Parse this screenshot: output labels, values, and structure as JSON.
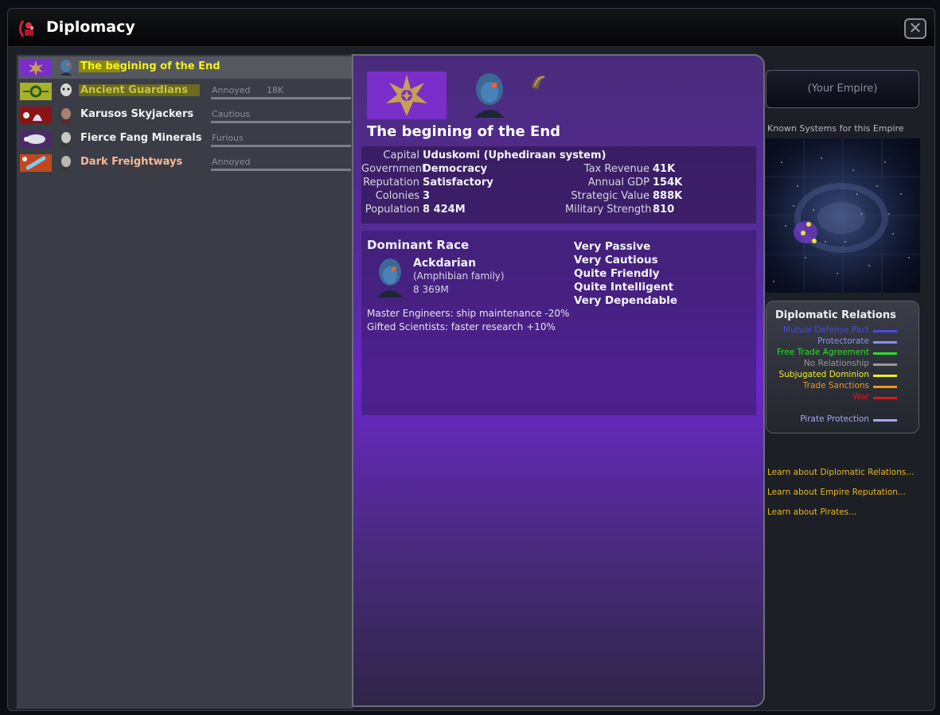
{
  "window": {
    "title": "Diplomacy",
    "close_label": "✕"
  },
  "empires": [
    {
      "name": "The begining of the End",
      "status": "",
      "score": "",
      "name_color": "#f7f020",
      "flag_bg": "#7a2ec9",
      "avatar": "ackdarian-avatar-icon",
      "selected": true
    },
    {
      "name": "Ancient Guardians",
      "status": "Annoyed",
      "score": "18K",
      "name_color": "#c8c440",
      "flag_bg": "#a8b02a",
      "avatar": "guardian-avatar-icon",
      "selected": false
    },
    {
      "name": "Karusos Skyjackers",
      "status": "Cautious",
      "score": "",
      "name_color": "#f2f2f4",
      "flag_bg": "#8a1414",
      "avatar": "pirate-avatar-icon",
      "selected": false
    },
    {
      "name": "Fierce Fang Minerals",
      "status": "Furious",
      "score": "",
      "name_color": "#f2f2f4",
      "flag_bg": "#4a2a6a",
      "avatar": "pirate-avatar-icon",
      "selected": false
    },
    {
      "name": "Dark Freightways",
      "status": "Annoyed",
      "score": "",
      "name_color": "#f8b898",
      "flag_bg": "#c0481e",
      "avatar": "pirate-avatar-icon",
      "selected": false
    }
  ],
  "detail": {
    "empire_name": "The begining of the End",
    "stats_left": [
      {
        "label": "Capital",
        "value": "Uduskomi (Uphediraan system)"
      },
      {
        "label": "Government",
        "value": "Democracy"
      },
      {
        "label": "Reputation",
        "value": "Satisfactory"
      },
      {
        "label": "Colonies",
        "value": "3"
      },
      {
        "label": "Population",
        "value": "8  424M"
      }
    ],
    "stats_right": [
      {
        "label": "Tax Revenue",
        "value": "41K"
      },
      {
        "label": "Annual GDP",
        "value": "154K"
      },
      {
        "label": "Strategic Value",
        "value": "888K"
      },
      {
        "label": "Military Strength",
        "value": "810"
      }
    ],
    "race": {
      "heading": "Dominant Race",
      "name": "Ackdarian",
      "family": "(Amphibian family)",
      "population": "8  369M",
      "bonuses": [
        "Master Engineers: ship maintenance -20%",
        "Gifted Scientists: faster research +10%"
      ],
      "traits": [
        "Very Passive",
        "Very Cautious",
        "Quite Friendly",
        "Quite Intelligent",
        "Very Dependable"
      ]
    }
  },
  "sidebar": {
    "your_empire_label": "(Your Empire)",
    "known_systems_label": "Known Systems for this Empire",
    "relations_title": "Diplomatic Relations",
    "relations": [
      {
        "label": "Mutual Defense Pact",
        "color": "#4a4ae8"
      },
      {
        "label": "Protectorate",
        "color": "#8890f0"
      },
      {
        "label": "Free Trade Agreement",
        "color": "#28e028"
      },
      {
        "label": "No Relationship",
        "color": "#9a9a9a"
      },
      {
        "label": "Subjugated Dominion",
        "color": "#f0f020"
      },
      {
        "label": "Trade Sanctions",
        "color": "#f09818"
      },
      {
        "label": "War",
        "color": "#e01818"
      },
      {
        "label": "Pirate Protection",
        "color": "#a8a8f0"
      }
    ],
    "links": [
      "Learn about Diplomatic Relations...",
      "Learn about Empire Reputation...",
      "Learn about Pirates..."
    ]
  }
}
